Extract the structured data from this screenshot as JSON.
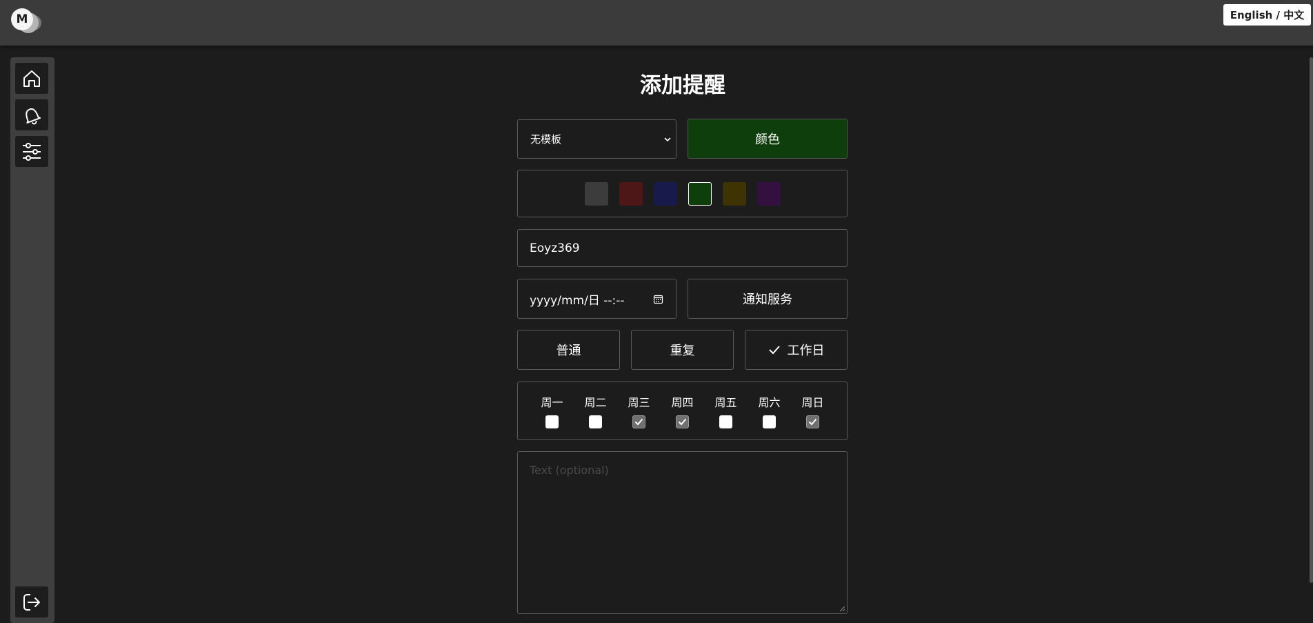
{
  "header": {
    "logo_letter": "M",
    "language_toggle": "English / 中文"
  },
  "sidebar": {
    "items": [
      {
        "icon": "home-icon"
      },
      {
        "icon": "bell-icon"
      },
      {
        "icon": "sliders-icon"
      }
    ],
    "bottom": {
      "icon": "logout-icon"
    }
  },
  "form": {
    "title": "添加提醒",
    "template_select": {
      "value": "无模板"
    },
    "color_button": "颜色",
    "selected_color": "#0d3e0b",
    "swatches": [
      {
        "color": "#3c3c3c",
        "selected": false
      },
      {
        "color": "#4d1717",
        "selected": false
      },
      {
        "color": "#171a4a",
        "selected": false
      },
      {
        "color": "#0d3e0b",
        "selected": true
      },
      {
        "color": "#3d3303",
        "selected": false
      },
      {
        "color": "#331040",
        "selected": false
      }
    ],
    "name_value": "Eoyz369",
    "datetime_placeholder": "yyyy/mm/日  --:--",
    "notify_service_button": "通知服务",
    "modes": [
      {
        "label": "普通",
        "checked": false
      },
      {
        "label": "重复",
        "checked": false
      },
      {
        "label": "工作日",
        "checked": true
      }
    ],
    "weekdays": [
      {
        "label": "周一",
        "checked": false
      },
      {
        "label": "周二",
        "checked": false
      },
      {
        "label": "周三",
        "checked": true
      },
      {
        "label": "周四",
        "checked": true
      },
      {
        "label": "周五",
        "checked": false
      },
      {
        "label": "周六",
        "checked": false
      },
      {
        "label": "周日",
        "checked": true
      }
    ],
    "text_placeholder": "Text (optional)"
  }
}
